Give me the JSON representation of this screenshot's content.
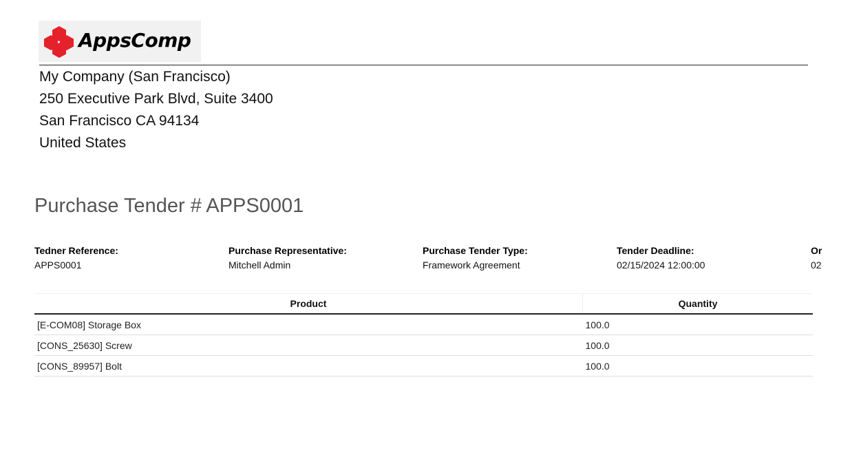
{
  "logo": {
    "text": "AppsComp",
    "icon": "red-hexagon-cluster-icon",
    "color": "#e5212b"
  },
  "company": {
    "name": "My Company (San Francisco)",
    "street": "250 Executive Park Blvd, Suite 3400",
    "city_line": "San Francisco CA 94134",
    "country": "United States"
  },
  "document": {
    "title": "Purchase Tender # APPS0001"
  },
  "info": [
    {
      "label": "Tedner Reference:",
      "value": "APPS0001"
    },
    {
      "label": "Purchase Representative:",
      "value": "Mitchell Admin"
    },
    {
      "label": "Purchase Tender Type:",
      "value": "Framework Agreement"
    },
    {
      "label": "Tender Deadline:",
      "value": "02/15/2024 12:00:00"
    },
    {
      "label": "Or",
      "value": "02"
    }
  ],
  "table": {
    "headers": {
      "product": "Product",
      "quantity": "Quantity"
    },
    "rows": [
      {
        "product": "[E-COM08] Storage Box",
        "quantity": "100.0"
      },
      {
        "product": "[CONS_25630] Screw",
        "quantity": "100.0"
      },
      {
        "product": "[CONS_89957] Bolt",
        "quantity": "100.0"
      }
    ]
  }
}
